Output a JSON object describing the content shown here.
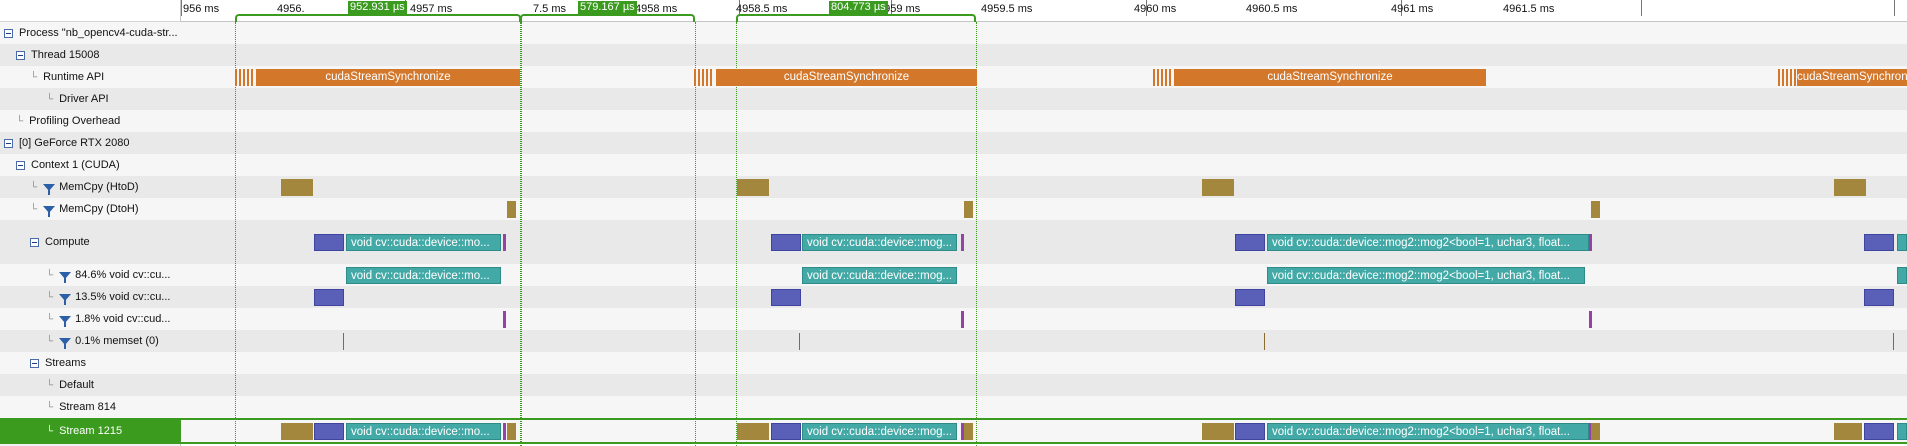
{
  "tree": [
    {
      "label": "Process \"nb_opencv4-cuda-str...",
      "kind": "toggle",
      "indent": 0,
      "shade": "plain"
    },
    {
      "label": "Thread 15008",
      "kind": "toggle",
      "indent": 1,
      "shade": "alt"
    },
    {
      "label": "Runtime API",
      "kind": "leaf",
      "indent": 2,
      "shade": "plain"
    },
    {
      "label": "Driver API",
      "kind": "leaf",
      "indent": 3,
      "shade": "alt"
    },
    {
      "label": "Profiling Overhead",
      "kind": "leaf",
      "indent": 1,
      "shade": "plain"
    },
    {
      "label": "[0] GeForce RTX 2080",
      "kind": "toggle",
      "indent": 0,
      "shade": "alt"
    },
    {
      "label": "Context 1 (CUDA)",
      "kind": "toggle",
      "indent": 1,
      "shade": "plain"
    },
    {
      "label": "MemCpy (HtoD)",
      "kind": "filter",
      "indent": 2,
      "shade": "alt"
    },
    {
      "label": "MemCpy (DtoH)",
      "kind": "filter",
      "indent": 2,
      "shade": "plain"
    },
    {
      "label": "Compute",
      "kind": "toggle",
      "indent": 2,
      "shade": "alt"
    },
    {
      "label": "84.6% void cv::cu...",
      "kind": "filter",
      "indent": 3,
      "shade": "plain"
    },
    {
      "label": "13.5% void cv::cu...",
      "kind": "filter",
      "indent": 3,
      "shade": "alt"
    },
    {
      "label": "1.8% void cv::cud...",
      "kind": "filter",
      "indent": 3,
      "shade": "plain"
    },
    {
      "label": "0.1% memset (0)",
      "kind": "filter",
      "indent": 3,
      "shade": "alt"
    },
    {
      "label": "Streams",
      "kind": "toggle",
      "indent": 2,
      "shade": "plain"
    },
    {
      "label": "Default",
      "kind": "leaf",
      "indent": 3,
      "shade": "alt"
    },
    {
      "label": "Stream 814",
      "kind": "leaf",
      "indent": 3,
      "shade": "plain"
    },
    {
      "label": "Stream 1215",
      "kind": "leaf",
      "indent": 3,
      "shade": "sel"
    }
  ],
  "ruler": {
    "labels": [
      "956 ms",
      "4956.",
      "4957 ms",
      "7.5 ms",
      "4958 ms",
      "4958.5 ms",
      "4959 ms",
      "4959.5 ms",
      "4960 ms",
      "4960.5 ms",
      "4961 ms",
      "4961.5 ms"
    ]
  },
  "selections": [
    {
      "duration": "952.931 µs"
    },
    {
      "duration": "579.167 µs"
    },
    {
      "duration": "804.773 µs"
    }
  ],
  "blocks": {
    "api_label": "cudaStreamSynchronize",
    "kernel_short": "void cv::cuda::device::mo...",
    "kernel_mid": "void cv::cuda::device::mog...",
    "kernel_long": "void cv::cuda::device::mog2::mog2<bool=1, uchar3, float..."
  },
  "colors": {
    "api": "#d3772b",
    "memcpy": "#a3873d",
    "kernel_main": "#43a9a6",
    "kernel_secondary": "#5a60b8",
    "kernel_small": "#9441a8",
    "selection": "#3b9b1f"
  }
}
